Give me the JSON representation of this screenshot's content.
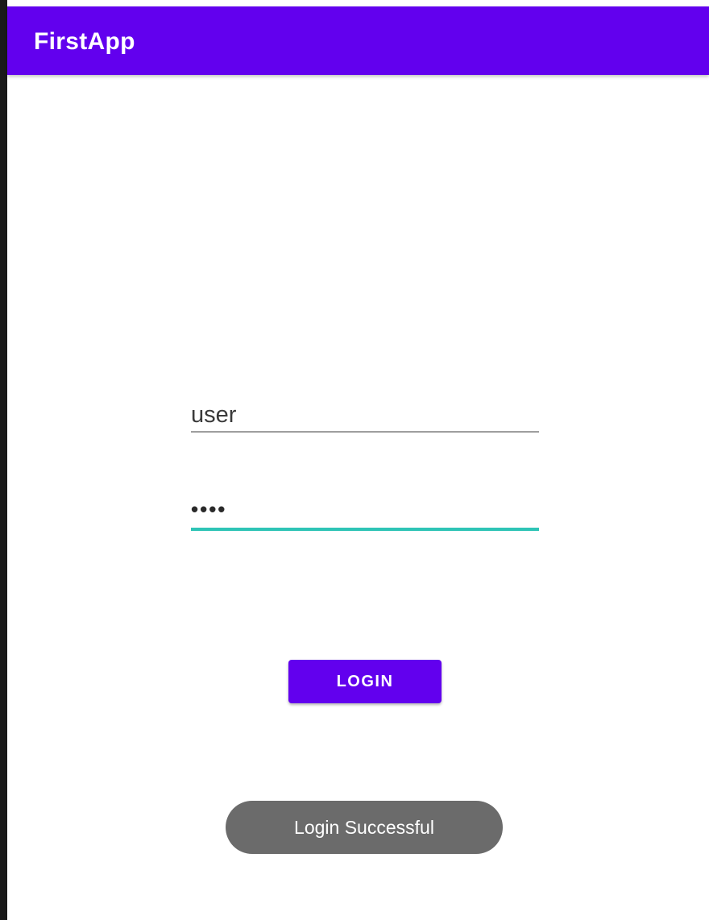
{
  "app_bar": {
    "title": "FirstApp",
    "color": "#6200ee"
  },
  "form": {
    "username": {
      "value": "user"
    },
    "password": {
      "value": "••••",
      "focus_color": "#2ec4b6"
    },
    "login_label": "LOGIN"
  },
  "toast": {
    "message": "Login Successful"
  }
}
